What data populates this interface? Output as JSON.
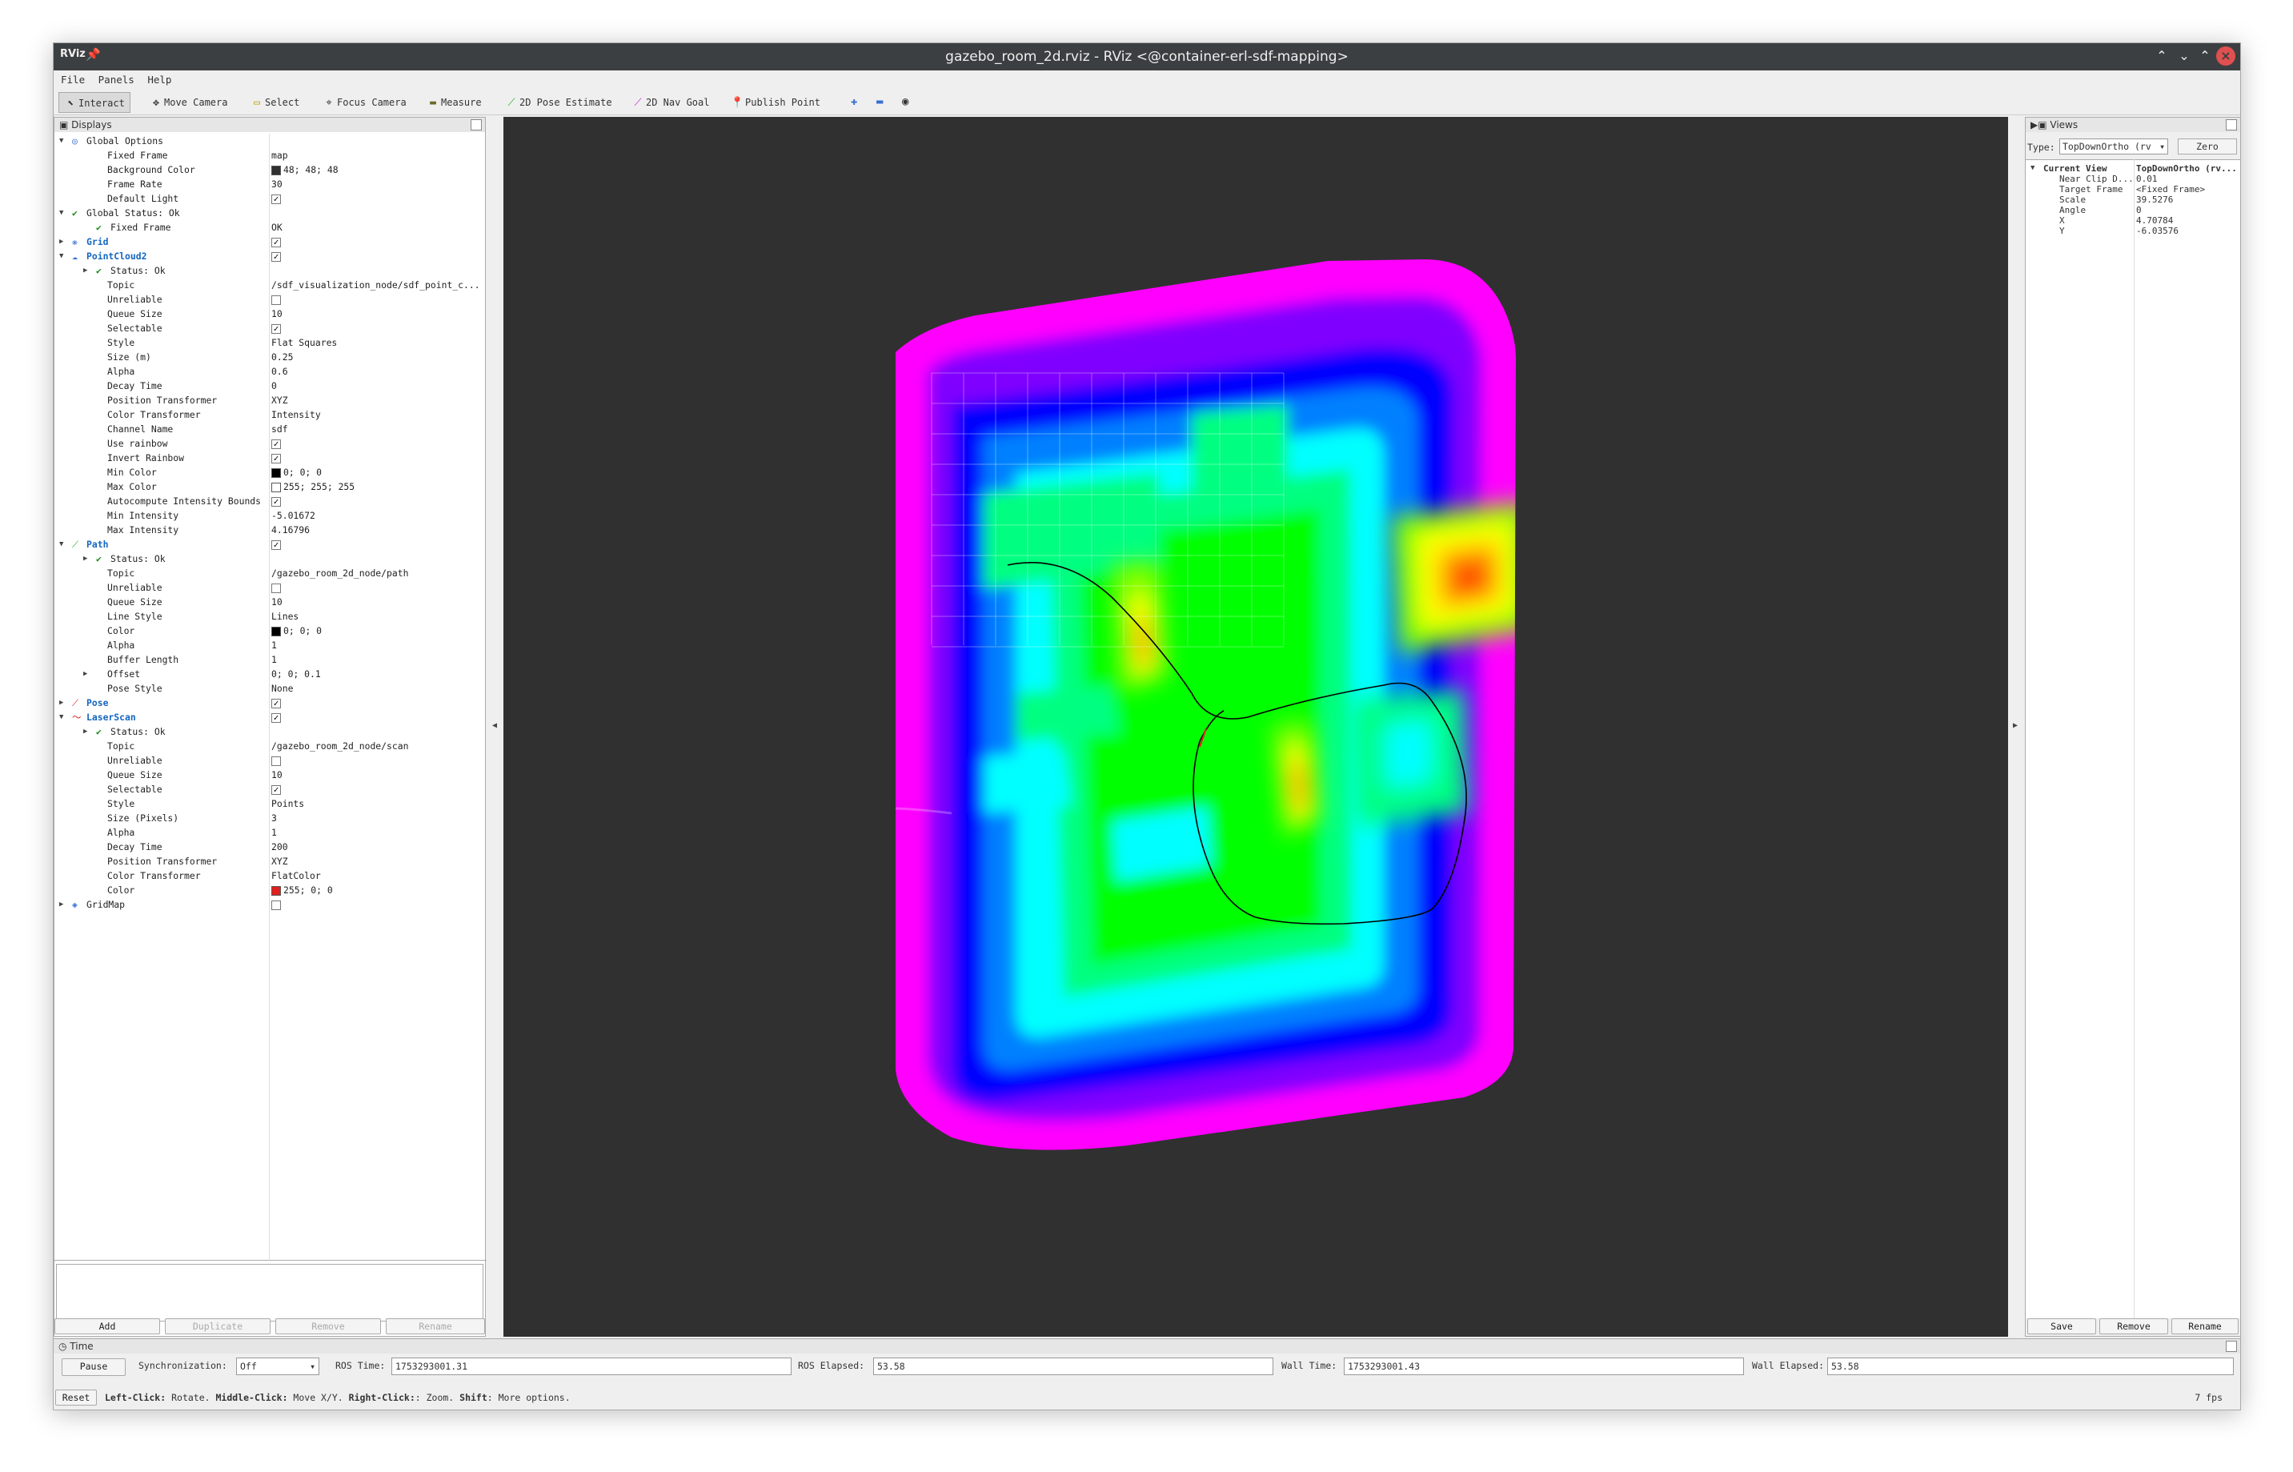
{
  "titlebar": {
    "title": "gazebo_room_2d.rviz - RViz <@container-erl-sdf-mapping>",
    "logo": "RViz"
  },
  "menu": [
    "File",
    "Panels",
    "Help"
  ],
  "toolbar": {
    "tools": [
      {
        "label": "Interact",
        "icon": "interact-icon"
      },
      {
        "label": "Move Camera",
        "icon": "move-camera-icon"
      },
      {
        "label": "Select",
        "icon": "select-icon"
      },
      {
        "label": "Focus Camera",
        "icon": "focus-camera-icon"
      },
      {
        "label": "Measure",
        "icon": "measure-icon"
      },
      {
        "label": "2D Pose Estimate",
        "icon": "pose-estimate-icon"
      },
      {
        "label": "2D Nav Goal",
        "icon": "nav-goal-icon"
      },
      {
        "label": "Publish Point",
        "icon": "publish-point-icon"
      }
    ]
  },
  "displays": {
    "title": "Displays",
    "rows": [
      {
        "d": 0,
        "arrow": "open",
        "icon": "globe",
        "k": "Global Options"
      },
      {
        "d": 1,
        "k": "Fixed Frame",
        "v": "map"
      },
      {
        "d": 1,
        "k": "Background Color",
        "v": "48; 48; 48",
        "sw": "#303030"
      },
      {
        "d": 1,
        "k": "Frame Rate",
        "v": "30"
      },
      {
        "d": 1,
        "k": "Default Light",
        "check": true
      },
      {
        "d": 0,
        "arrow": "open",
        "icon": "ok",
        "k": "Global Status: Ok"
      },
      {
        "d": 1,
        "icon": "ok",
        "k": "Fixed Frame",
        "v": "OK"
      },
      {
        "d": 0,
        "arrow": "closed",
        "icon": "grid",
        "k": "Grid",
        "plugin": true,
        "check": true
      },
      {
        "d": 0,
        "arrow": "open",
        "icon": "cloud",
        "k": "PointCloud2",
        "plugin": true,
        "check": true
      },
      {
        "d": 1,
        "arrow": "closed",
        "icon": "ok",
        "k": "Status: Ok"
      },
      {
        "d": 1,
        "k": "Topic",
        "v": "/sdf_visualization_node/sdf_point_c..."
      },
      {
        "d": 1,
        "k": "Unreliable",
        "check": false
      },
      {
        "d": 1,
        "k": "Queue Size",
        "v": "10"
      },
      {
        "d": 1,
        "k": "Selectable",
        "check": true
      },
      {
        "d": 1,
        "k": "Style",
        "v": "Flat Squares"
      },
      {
        "d": 1,
        "k": "Size (m)",
        "v": "0.25"
      },
      {
        "d": 1,
        "k": "Alpha",
        "v": "0.6"
      },
      {
        "d": 1,
        "k": "Decay Time",
        "v": "0"
      },
      {
        "d": 1,
        "k": "Position Transformer",
        "v": "XYZ"
      },
      {
        "d": 1,
        "k": "Color Transformer",
        "v": "Intensity"
      },
      {
        "d": 1,
        "k": "Channel Name",
        "v": "sdf"
      },
      {
        "d": 1,
        "k": "Use rainbow",
        "check": true
      },
      {
        "d": 1,
        "k": "Invert Rainbow",
        "check": true
      },
      {
        "d": 1,
        "k": "Min Color",
        "v": "0; 0; 0",
        "sw": "#000000"
      },
      {
        "d": 1,
        "k": "Max Color",
        "v": "255; 255; 255",
        "sw": "#ffffff"
      },
      {
        "d": 1,
        "k": "Autocompute Intensity Bounds",
        "check": true
      },
      {
        "d": 1,
        "k": "Min Intensity",
        "v": "-5.01672"
      },
      {
        "d": 1,
        "k": "Max Intensity",
        "v": "4.16796"
      },
      {
        "d": 0,
        "arrow": "open",
        "icon": "path",
        "k": "Path",
        "plugin": true,
        "check": true
      },
      {
        "d": 1,
        "arrow": "closed",
        "icon": "ok",
        "k": "Status: Ok"
      },
      {
        "d": 1,
        "k": "Topic",
        "v": "/gazebo_room_2d_node/path"
      },
      {
        "d": 1,
        "k": "Unreliable",
        "check": false
      },
      {
        "d": 1,
        "k": "Queue Size",
        "v": "10"
      },
      {
        "d": 1,
        "k": "Line Style",
        "v": "Lines"
      },
      {
        "d": 1,
        "k": "Color",
        "v": "0; 0; 0",
        "sw": "#000000"
      },
      {
        "d": 1,
        "k": "Alpha",
        "v": "1"
      },
      {
        "d": 1,
        "k": "Buffer Length",
        "v": "1"
      },
      {
        "d": 1,
        "arrow": "closed",
        "k": "Offset",
        "v": "0; 0; 0.1"
      },
      {
        "d": 1,
        "k": "Pose Style",
        "v": "None"
      },
      {
        "d": 0,
        "arrow": "closed",
        "icon": "pose",
        "k": "Pose",
        "plugin": true,
        "check": true
      },
      {
        "d": 0,
        "arrow": "open",
        "icon": "scan",
        "k": "LaserScan",
        "plugin": true,
        "check": true
      },
      {
        "d": 1,
        "arrow": "closed",
        "icon": "ok",
        "k": "Status: Ok"
      },
      {
        "d": 1,
        "k": "Topic",
        "v": "/gazebo_room_2d_node/scan"
      },
      {
        "d": 1,
        "k": "Unreliable",
        "check": false
      },
      {
        "d": 1,
        "k": "Queue Size",
        "v": "10"
      },
      {
        "d": 1,
        "k": "Selectable",
        "check": true
      },
      {
        "d": 1,
        "k": "Style",
        "v": "Points"
      },
      {
        "d": 1,
        "k": "Size (Pixels)",
        "v": "3"
      },
      {
        "d": 1,
        "k": "Alpha",
        "v": "1"
      },
      {
        "d": 1,
        "k": "Decay Time",
        "v": "200"
      },
      {
        "d": 1,
        "k": "Position Transformer",
        "v": "XYZ"
      },
      {
        "d": 1,
        "k": "Color Transformer",
        "v": "FlatColor"
      },
      {
        "d": 1,
        "k": "Color",
        "v": "255; 0; 0",
        "sw": "#e02020"
      },
      {
        "d": 0,
        "arrow": "closed",
        "icon": "gridmap",
        "k": "GridMap",
        "check": false
      }
    ],
    "buttons": {
      "add": "Add",
      "duplicate": "Duplicate",
      "remove": "Remove",
      "rename": "Rename"
    }
  },
  "views": {
    "title": "Views",
    "type_label": "Type:",
    "type_value": "TopDownOrtho (rv",
    "zero": "Zero",
    "rows": [
      {
        "k": "Current View",
        "v": "TopDownOrtho (rv...",
        "bold": true
      },
      {
        "k": "Near Clip D...",
        "v": "0.01"
      },
      {
        "k": "Target Frame",
        "v": "<Fixed Frame>"
      },
      {
        "k": "Scale",
        "v": "39.5276"
      },
      {
        "k": "Angle",
        "v": "0"
      },
      {
        "k": "X",
        "v": "4.70784"
      },
      {
        "k": "Y",
        "v": "-6.03576"
      }
    ],
    "buttons": {
      "save": "Save",
      "remove": "Remove",
      "rename": "Rename"
    }
  },
  "time": {
    "title": "Time",
    "pause": "Pause",
    "sync_label": "Synchronization:",
    "sync_value": "Off",
    "ros_time_label": "ROS Time:",
    "ros_time": "1753293001.31",
    "ros_elapsed_label": "ROS Elapsed:",
    "ros_elapsed": "53.58",
    "wall_time_label": "Wall Time:",
    "wall_time": "1753293001.43",
    "wall_elapsed_label": "Wall Elapsed:",
    "wall_elapsed": "53.58"
  },
  "status": {
    "reset": "Reset",
    "hint": [
      {
        "b": "Left-Click:",
        "t": " Rotate. "
      },
      {
        "b": "Middle-Click:",
        "t": " Move X/Y. "
      },
      {
        "b": "Right-Click:",
        "t": ": Zoom. "
      },
      {
        "b": "Shift",
        "t": ": More options."
      }
    ],
    "fps": "7 fps"
  },
  "colors": {
    "background": "#303030",
    "path": "#000000",
    "laser": "#e02020"
  }
}
